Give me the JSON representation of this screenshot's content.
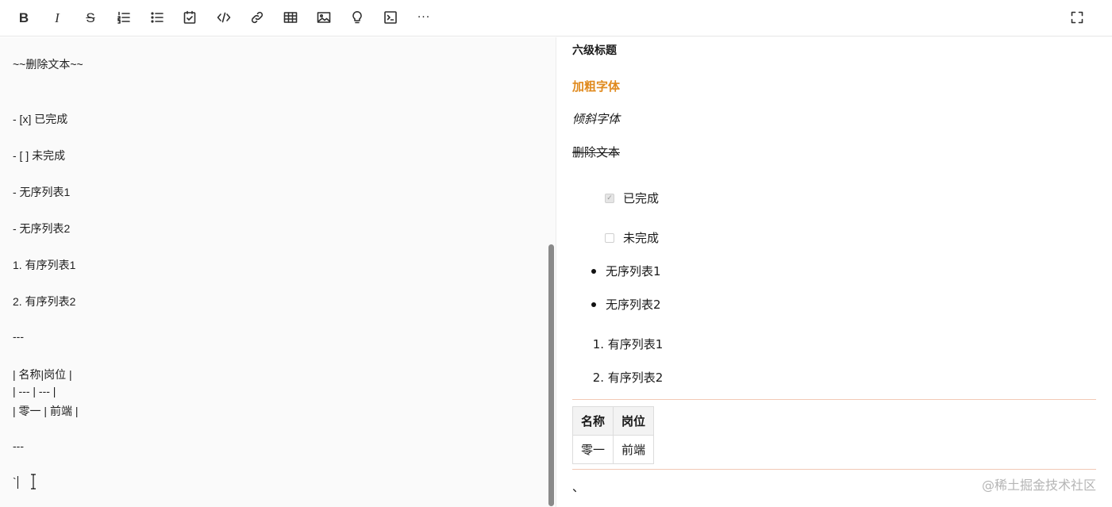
{
  "toolbar": {
    "buttons": [
      {
        "name": "bold",
        "glyph": "B"
      },
      {
        "name": "italic",
        "glyph": "I"
      },
      {
        "name": "strikethrough",
        "glyph": "S"
      },
      {
        "name": "ordered-list"
      },
      {
        "name": "unordered-list"
      },
      {
        "name": "task-list"
      },
      {
        "name": "code"
      },
      {
        "name": "link"
      },
      {
        "name": "table"
      },
      {
        "name": "image"
      },
      {
        "name": "tip"
      },
      {
        "name": "terminal"
      },
      {
        "name": "more",
        "glyph": "···"
      }
    ]
  },
  "editor": {
    "lines": [
      "~~删除文本~~",
      "- [x] 已完成",
      "- [ ] 未完成",
      "- 无序列表1",
      "- 无序列表2",
      "1. 有序列表1",
      "2. 有序列表2",
      "---",
      "| 名称|岗位 |",
      "| --- | --- |",
      "| 零一 | 前端 |",
      "---",
      "`"
    ]
  },
  "preview": {
    "heading6": "六级标题",
    "bold": "加粗字体",
    "italic": "倾斜字体",
    "strike": "删除文本",
    "tasks": [
      {
        "label": "已完成",
        "checked": true
      },
      {
        "label": "未完成",
        "checked": false
      }
    ],
    "unordered": [
      "无序列表1",
      "无序列表2"
    ],
    "ordered": [
      {
        "num": "1.",
        "label": "有序列表1"
      },
      {
        "num": "2.",
        "label": "有序列表2"
      }
    ],
    "table": {
      "headers": [
        "名称",
        "岗位"
      ],
      "rows": [
        [
          "零一",
          "前端"
        ]
      ]
    },
    "tail": "、"
  },
  "watermark": "@稀土掘金技术社区",
  "colors": {
    "bold_text": "#e08a1e",
    "hr": "#f2c9b5",
    "scrollbar": "#8a8a8a"
  }
}
